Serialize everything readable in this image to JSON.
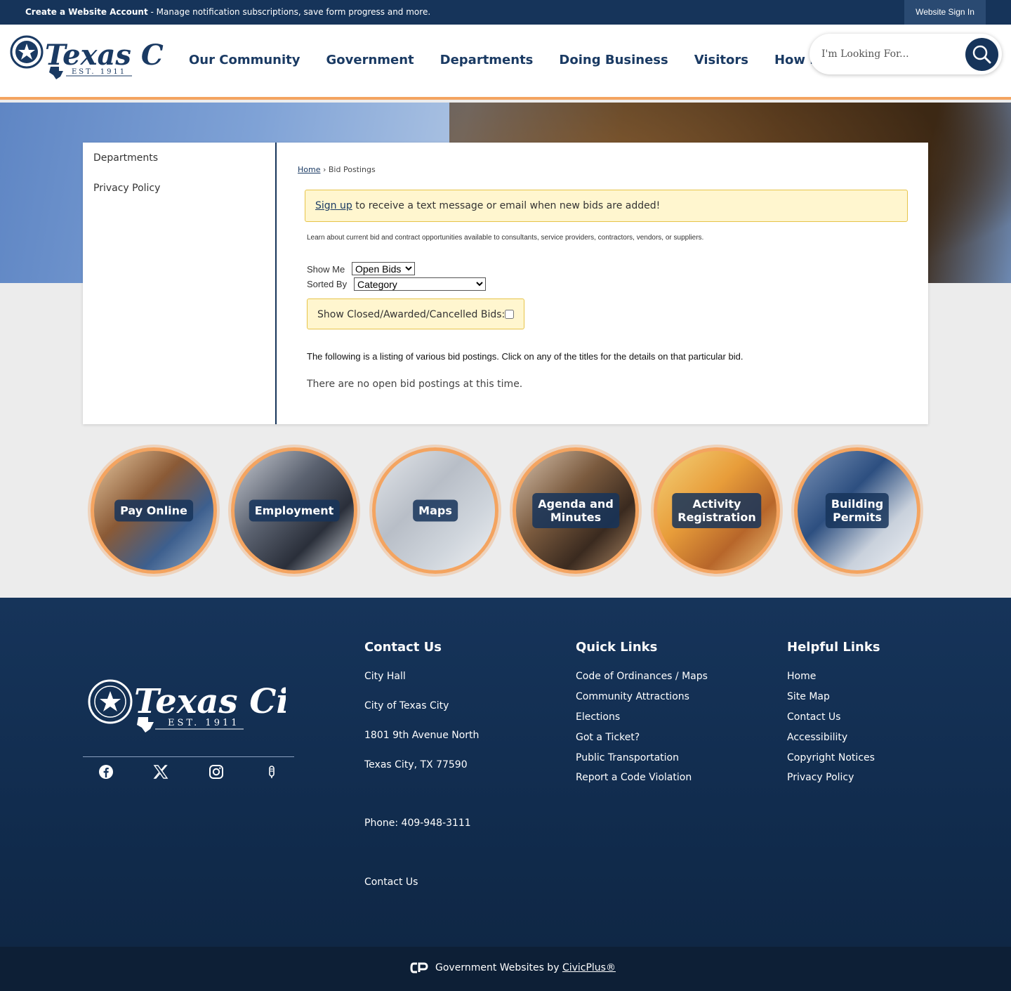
{
  "topbar": {
    "create_bold": "Create a Website Account",
    "create_rest": " - Manage notification subscriptions, save form progress and more.",
    "signin": "Website Sign In"
  },
  "header": {
    "logo_text": "Texas City",
    "logo_est": "EST. 1911",
    "nav": [
      "Our Community",
      "Government",
      "Departments",
      "Doing Business",
      "Visitors",
      "How Do I..."
    ],
    "search_placeholder": "I'm Looking For..."
  },
  "sidebar": {
    "items": [
      "Departments",
      "Privacy Policy"
    ]
  },
  "main": {
    "breadcrumb_home": "Home",
    "breadcrumb_sep": " › ",
    "breadcrumb_current": "Bid Postings",
    "alert_link": "Sign up",
    "alert_text": " to receive a text message or email when new bids are added!",
    "intro": "Learn about current bid and contract opportunities available to consultants, service providers, contractors, vendors, or suppliers.",
    "show_me_label": "Show Me",
    "show_me_value": "Open Bids",
    "sorted_by_label": "Sorted By",
    "sorted_by_value": "Category",
    "closed_label": "Show Closed/Awarded/Cancelled Bids:",
    "listing_text": "The following is a listing of various bid postings. Click on any of the titles for the details on that particular bid.",
    "none_text": "There are no open bid postings at this time."
  },
  "quick_links": [
    {
      "line1": "Pay Online",
      "line2": ""
    },
    {
      "line1": "Employment",
      "line2": ""
    },
    {
      "line1": "Maps",
      "line2": ""
    },
    {
      "line1": "Agenda and",
      "line2": "Minutes"
    },
    {
      "line1": "Activity",
      "line2": "Registration"
    },
    {
      "line1": "Building",
      "line2": "Permits"
    }
  ],
  "footer": {
    "contact": {
      "title": "Contact Us",
      "lines": [
        "City Hall",
        "City of Texas City",
        "1801 9th Avenue North",
        "Texas City, TX 77590",
        "Phone: 409-948-3111",
        "Contact Us"
      ]
    },
    "quick": {
      "title": "Quick Links",
      "links": [
        "Code of Ordinances / Maps",
        "Community Attractions",
        "Elections",
        "Got a Ticket?",
        "Public Transportation",
        "Report a Code Violation"
      ]
    },
    "helpful": {
      "title": "Helpful Links",
      "links": [
        "Home",
        "Site Map",
        "Contact Us",
        "Accessibility",
        "Copyright Notices",
        "Privacy Policy"
      ]
    },
    "social_icons": [
      "facebook-icon",
      "x-icon",
      "instagram-icon",
      "notify-icon"
    ],
    "bottom_text": "Government Websites by ",
    "bottom_link": "CivicPlus®"
  },
  "colors": {
    "navy": "#16345a",
    "accent": "#f4a460",
    "alert_bg": "#fff6cf"
  }
}
